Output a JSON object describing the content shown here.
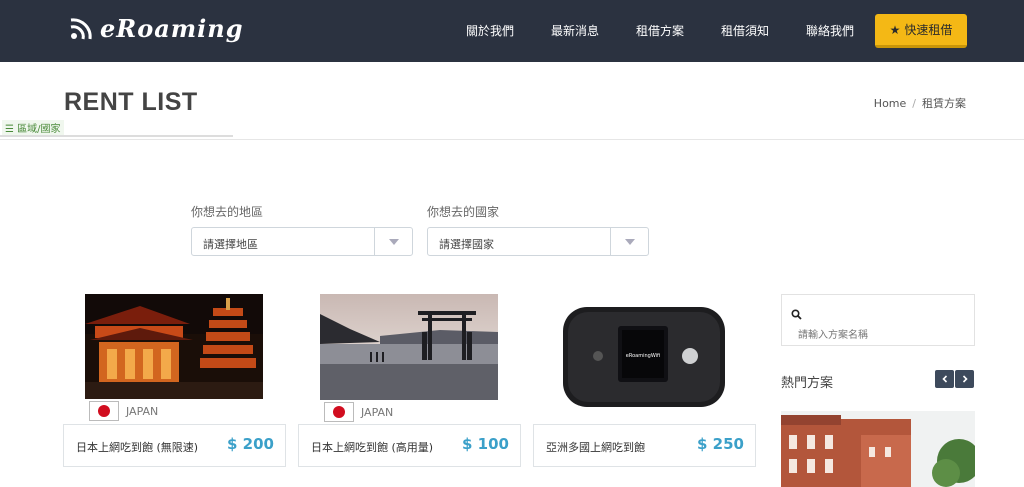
{
  "header": {
    "logo_text": "eRoaming",
    "nav": [
      "關於我們",
      "最新消息",
      "租借方案",
      "租借須知",
      "聯絡我們"
    ],
    "quick_button": "快速租借"
  },
  "title_bar": {
    "title": "RENT LIST",
    "breadcrumb": [
      "Home",
      "租賃方案"
    ],
    "mini_tag": "☰ 區域/國家"
  },
  "filters": {
    "region_label": "你想去的地區",
    "region_value": "請選擇地區",
    "country_label": "你想去的國家",
    "country_value": "請選擇國家"
  },
  "products": [
    {
      "country": "JAPAN",
      "name": "日本上網吃到飽 (無限速)",
      "price": "$ 200"
    },
    {
      "country": "JAPAN",
      "name": "日本上網吃到飽 (高用量)",
      "price": "$ 100"
    },
    {
      "country": "",
      "name": "亞洲多國上網吃到飽",
      "price": "$ 250"
    }
  ],
  "sidebar": {
    "search_placeholder": "請輸入方案名稱",
    "hot_title": "熱門方案",
    "device_label": "eRoamingWifi"
  },
  "colors": {
    "header_bg": "#2b3240",
    "accent_yellow": "#f4b815",
    "price_blue": "#3ba0c9"
  }
}
